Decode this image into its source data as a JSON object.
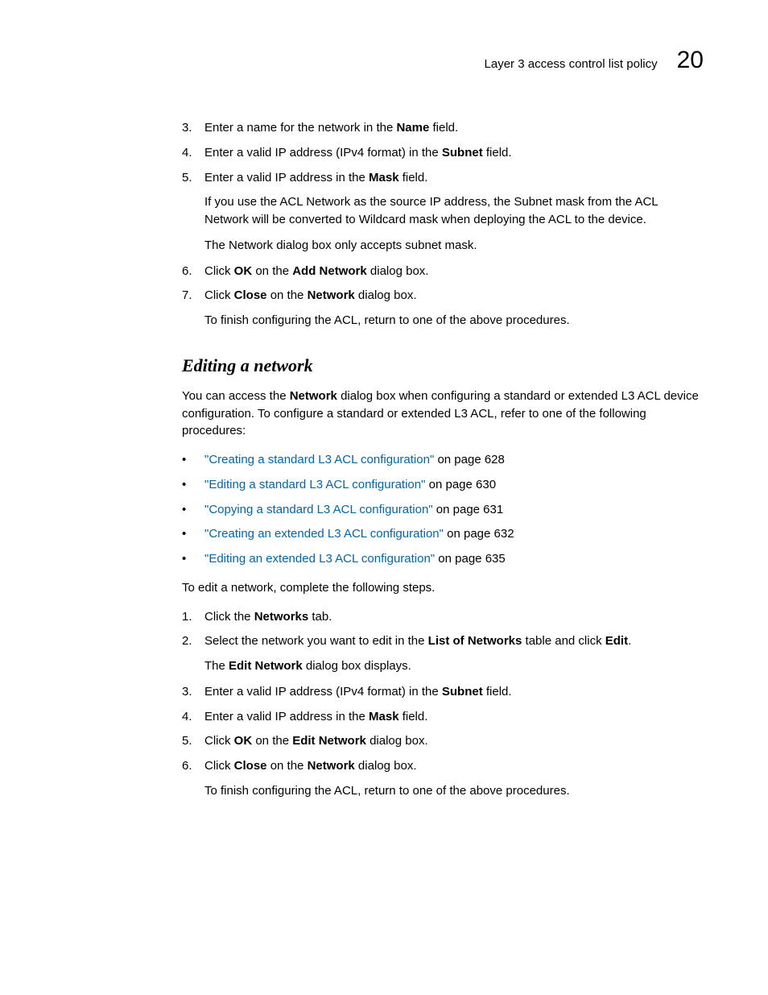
{
  "header": {
    "title": "Layer 3 access control list policy",
    "chapter": "20"
  },
  "top_steps": {
    "s3_a": "Enter a name for the network in the ",
    "s3_bold": "Name",
    "s3_b": " field.",
    "s4_a": "Enter a valid IP address (IPv4 format) in the ",
    "s4_bold": "Subnet",
    "s4_b": " field.",
    "s5_a": "Enter a valid IP address in the ",
    "s5_bold": "Mask",
    "s5_b": " field.",
    "s5_sub1": "If you use the ACL Network as the source IP address, the Subnet mask from the ACL Network will be converted to Wildcard mask when deploying the ACL to the device.",
    "s5_sub2": "The Network dialog box only accepts subnet mask.",
    "s6_a": "Click ",
    "s6_bold1": "OK",
    "s6_mid": " on the ",
    "s6_bold2": "Add Network",
    "s6_b": " dialog box.",
    "s7_a": "Click ",
    "s7_bold1": "Close",
    "s7_mid": " on the ",
    "s7_bold2": "Network",
    "s7_b": " dialog box.",
    "s7_sub": "To finish configuring the ACL, return to one of the above procedures."
  },
  "section_heading": "Editing a network",
  "para1_a": "You can access the ",
  "para1_bold": "Network",
  "para1_b": " dialog box when configuring a standard or extended L3 ACL device configuration. To configure a standard or extended L3 ACL, refer to one of the following procedures:",
  "refs": {
    "r1_link": "\"Creating a standard L3 ACL configuration\"",
    "r1_tail": " on page 628",
    "r2_link": "\"Editing a standard L3 ACL configuration\"",
    "r2_tail": " on page 630",
    "r3_link": "\"Copying a standard L3 ACL configuration\"",
    "r3_tail": " on page 631",
    "r4_link": "\"Creating an extended L3 ACL configuration\"",
    "r4_tail": " on page 632",
    "r5_link": "\"Editing an extended L3 ACL configuration\"",
    "r5_tail": " on page 635"
  },
  "edit_intro": "To edit a network, complete the following steps.",
  "edit_steps": {
    "e1_a": "Click the ",
    "e1_bold": "Networks",
    "e1_b": " tab.",
    "e2_a": "Select the network you want to edit in the ",
    "e2_bold1": "List of Networks",
    "e2_mid": " table and click ",
    "e2_bold2": "Edit",
    "e2_b": ".",
    "e2_sub_a": "The ",
    "e2_sub_bold": "Edit Network",
    "e2_sub_b": " dialog box displays.",
    "e3_a": "Enter a valid IP address (IPv4 format) in the ",
    "e3_bold": "Subnet",
    "e3_b": " field.",
    "e4_a": "Enter a valid IP address in the ",
    "e4_bold": "Mask",
    "e4_b": " field.",
    "e5_a": "Click ",
    "e5_bold1": "OK",
    "e5_mid": " on the ",
    "e5_bold2": "Edit Network",
    "e5_b": " dialog box.",
    "e6_a": "Click ",
    "e6_bold1": "Close",
    "e6_mid": " on the ",
    "e6_bold2": "Network",
    "e6_b": " dialog box.",
    "e6_sub": "To finish configuring the ACL, return to one of the above procedures."
  },
  "nums": {
    "n3": "3.",
    "n4": "4.",
    "n5": "5.",
    "n6": "6.",
    "n7": "7.",
    "m1": "1.",
    "m2": "2.",
    "m3": "3.",
    "m4": "4.",
    "m5": "5.",
    "m6": "6."
  },
  "bullet": "•"
}
